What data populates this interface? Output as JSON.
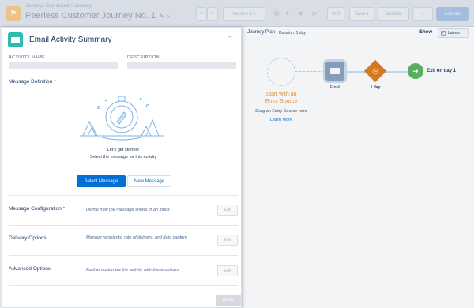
{
  "header": {
    "breadcrumb": "Journeys Dashboard > Journey",
    "title": "Peerless Customer Journey No. 1",
    "version": "Version 1",
    "save_label": "Save",
    "validate_label": "Validate",
    "activate_label": "Activate",
    "count_badge": "0"
  },
  "canvas": {
    "plan_label": "Journey Plan",
    "duration": "Duration: 1 day",
    "show_label": "Show",
    "labels_toggle": "Labels",
    "start_line1": "Start with an",
    "start_line2": "Entry Source",
    "drag_text": "Drag an Entry Source here",
    "learn_more": "Learn More",
    "email_node_label": "Email",
    "wait_node_label": "1 day",
    "exit_label": "Exit on day 1"
  },
  "panel": {
    "title": "Email Activity Summary",
    "activity_name_label": "ACTIVITY NAME",
    "description_label": "DESCRIPTION",
    "message_definition_label": "Message Definition",
    "required_mark": "*",
    "getting_started": "Let's get started!",
    "select_prompt": "Select the message for this activity",
    "select_message_btn": "Select Message",
    "new_message_btn": "New Message",
    "sections": [
      {
        "title": "Message Configuration",
        "required": true,
        "desc": "Define how the message shows in an inbox",
        "edit": "Edit"
      },
      {
        "title": "Delivery Options",
        "required": false,
        "desc": "Manage recipients, rate of delivery, and data capture",
        "edit": "Edit"
      },
      {
        "title": "Advanced Options",
        "required": false,
        "desc": "Further customize the activity with these options",
        "edit": "Edit"
      }
    ],
    "done_label": "Done"
  },
  "colors": {
    "brand_blue": "#0070d2",
    "email_teal": "#2abdad",
    "wait_orange": "#e0791b",
    "exit_green": "#5ab55b",
    "entry_orange_text": "#f0923f"
  }
}
